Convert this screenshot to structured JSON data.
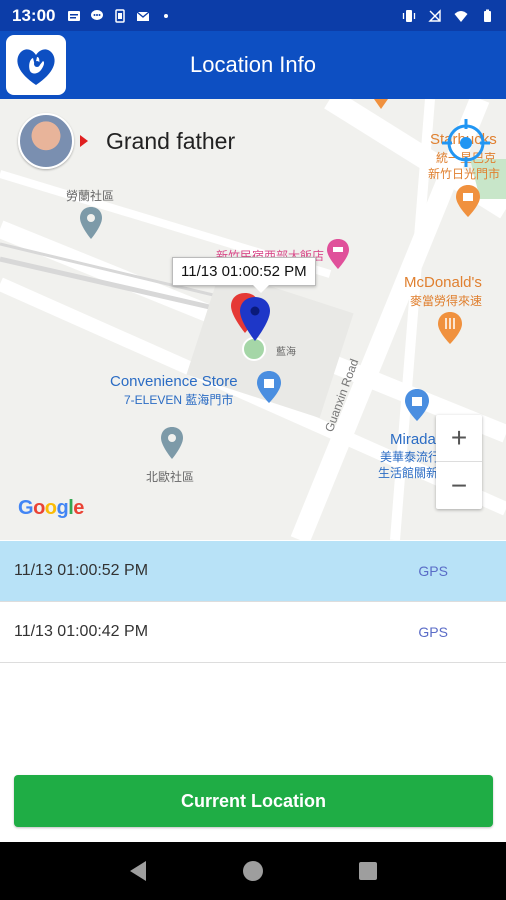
{
  "status_bar": {
    "time": "13:00",
    "icons_left": [
      "message-icon",
      "chat-icon",
      "battery-saver-icon",
      "mail-icon",
      "dot-icon"
    ],
    "icons_right": [
      "vibrate-icon",
      "no-signal-icon",
      "wifi-icon",
      "battery-icon"
    ]
  },
  "app_bar": {
    "title": "Location Info"
  },
  "profile": {
    "name": "Grand father"
  },
  "map": {
    "marker_time": "11/13 01:00:52 PM",
    "labels": {
      "area1": "勞蘭社區",
      "area2": "北歐社區",
      "convenience_store": "Convenience Store",
      "seven_eleven": "7-ELEVEN 藍海門市",
      "mcdonalds": "McDonald's",
      "mcdonalds_cn": "麥當勞得來速",
      "starbucks": "Starbucks",
      "starbucks_cn": "統一星巴克",
      "starbucks_cn2": "新竹日光門市",
      "guanxin_road": "Guanxin Road",
      "mirada": "Mirada",
      "mirada_cn1": "美華泰流行",
      "mirada_cn2": "生活館關新店",
      "landmark": "藍海",
      "pink_poi": "新竹民宿西部大飯店"
    },
    "zoom_in": "+",
    "zoom_out": "−",
    "google": {
      "G": "G",
      "o1": "o",
      "o2": "o",
      "g": "g",
      "l": "l",
      "e": "e"
    }
  },
  "history": [
    {
      "time": "11/13 01:00:52 PM",
      "source": "GPS",
      "selected": true
    },
    {
      "time": "11/13 01:00:42 PM",
      "source": "GPS",
      "selected": false
    }
  ],
  "cta": {
    "label": "Current Location"
  },
  "colors": {
    "primary": "#0d4fc2",
    "accent_green": "#1fad45",
    "selected_row": "#b8e2f7"
  }
}
